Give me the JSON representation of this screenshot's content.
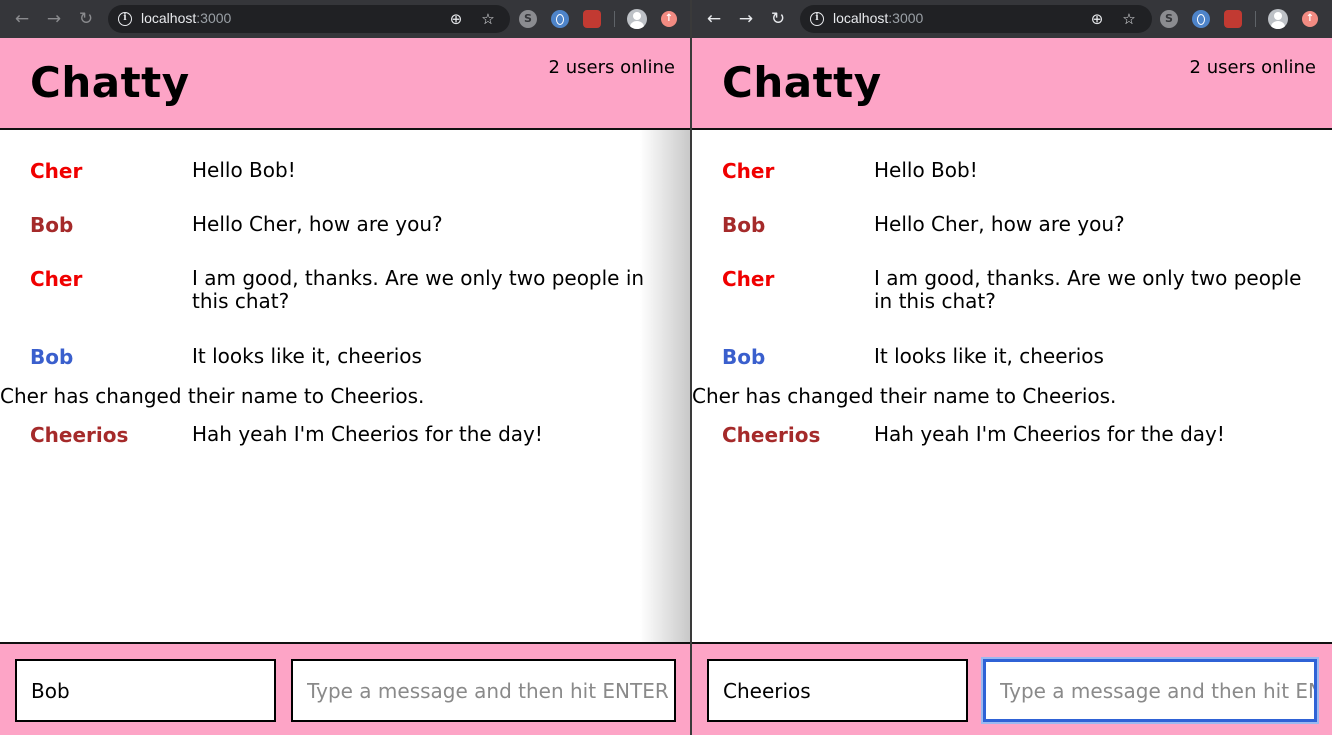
{
  "browser": {
    "url_host": "localhost",
    "url_port": ":3000",
    "icons": [
      "back-arrow-icon",
      "forward-arrow-icon",
      "reload-icon",
      "info-icon",
      "zoom-icon",
      "star-icon",
      "skype-extension-icon",
      "extension-icon",
      "extension-icon",
      "profile-avatar-icon",
      "update-icon"
    ],
    "glyphs": {
      "back": "←",
      "forward": "→",
      "reload": "↻",
      "info": "i",
      "zoom": "⊕",
      "star": "☆",
      "ext_s": "S",
      "update": "↑"
    }
  },
  "app": {
    "title": "Chatty",
    "online_count": "2 users online",
    "colors": {
      "header_bg": "#fda4c6",
      "cher": "#f00000",
      "bob_dark": "#a52a2a",
      "bob_blue": "#3a5fcd",
      "cheerios": "#a52a2a"
    }
  },
  "messages": [
    {
      "type": "message",
      "user": "Cher",
      "content": "Hello Bob!",
      "color": "#f00000"
    },
    {
      "type": "message",
      "user": "Bob",
      "content": "Hello Cher, how are you?",
      "color": "#a52a2a"
    },
    {
      "type": "message",
      "user": "Cher",
      "content": "I am good, thanks. Are we only two people in this chat?",
      "color": "#f00000"
    },
    {
      "type": "message",
      "user": "Bob",
      "content": "It looks like it, cheerios",
      "color": "#3a5fcd"
    },
    {
      "type": "notification",
      "content": "Cher has changed their name to Cheerios."
    },
    {
      "type": "message",
      "user": "Cheerios",
      "content": "Hah yeah I'm Cheerios for the day!",
      "color": "#a52a2a"
    }
  ],
  "windows": [
    {
      "username": "Bob",
      "message_placeholder": "Type a message and then hit ENTER",
      "message_value": ""
    },
    {
      "username": "Cheerios",
      "message_placeholder": "Type a message and then hit ENTER",
      "message_value": ""
    }
  ]
}
